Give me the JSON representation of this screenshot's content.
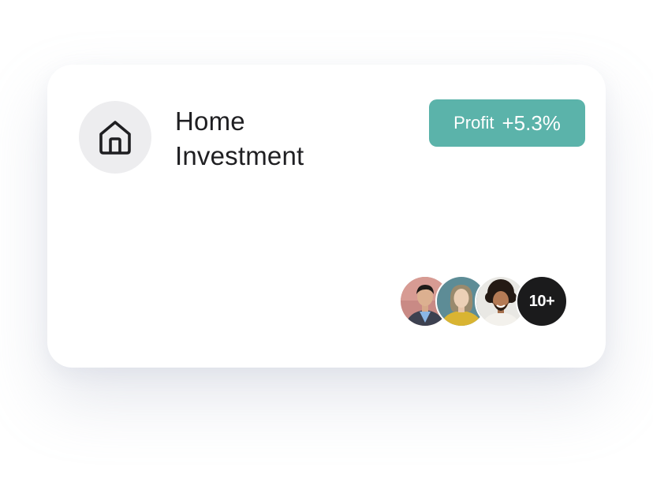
{
  "card": {
    "icon": "home-icon",
    "title_line1": "Home",
    "title_line2": "Investment",
    "profit_label": "Profit",
    "profit_value": "+5.3%",
    "members_more": "10+"
  },
  "colors": {
    "accent": "#5bb3aa",
    "icon_bg": "#ededef",
    "text": "#1f1f22",
    "more_badge": "#1b1b1c"
  }
}
